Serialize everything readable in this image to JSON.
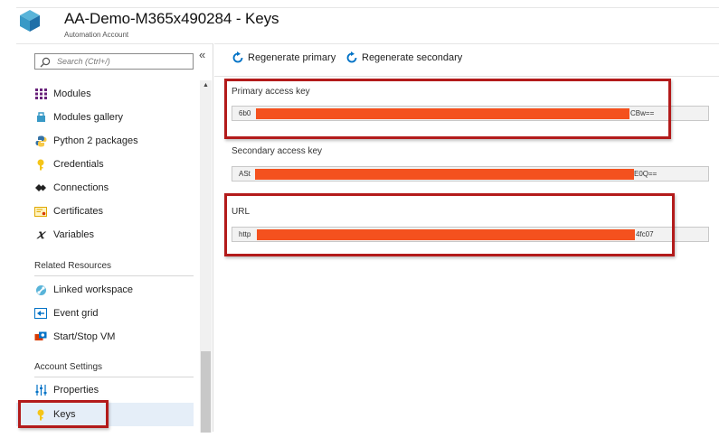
{
  "header": {
    "title": "AA-Demo-M365x490284 - Keys",
    "subtitle": "Automation Account",
    "icon": "cube-icon"
  },
  "sidebar": {
    "search_placeholder": "Search (Ctrl+/)",
    "collapse_glyph": "«",
    "items": [
      {
        "label": "Modules",
        "icon": "modules-icon"
      },
      {
        "label": "Modules gallery",
        "icon": "gallery-icon"
      },
      {
        "label": "Python 2 packages",
        "icon": "python-icon"
      },
      {
        "label": "Credentials",
        "icon": "key-icon"
      },
      {
        "label": "Connections",
        "icon": "connections-icon"
      },
      {
        "label": "Certificates",
        "icon": "certificate-icon"
      },
      {
        "label": "Variables",
        "icon": "variable-icon"
      }
    ],
    "related_header": "Related Resources",
    "related_items": [
      {
        "label": "Linked workspace",
        "icon": "workspace-icon"
      },
      {
        "label": "Event grid",
        "icon": "event-grid-icon"
      },
      {
        "label": "Start/Stop VM",
        "icon": "vm-icon"
      }
    ],
    "settings_header": "Account Settings",
    "settings_items": [
      {
        "label": "Properties",
        "icon": "properties-icon"
      },
      {
        "label": "Keys",
        "icon": "key-icon",
        "selected": true
      }
    ]
  },
  "toolbar": {
    "regen_primary": "Regenerate primary",
    "regen_secondary": "Regenerate secondary"
  },
  "fields": {
    "primary_label": "Primary access key",
    "primary_prefix": "6b0",
    "primary_suffix": "CBw==",
    "secondary_label": "Secondary access key",
    "secondary_prefix": "ASt",
    "secondary_suffix": "E0Q==",
    "url_label": "URL",
    "url_prefix": "http",
    "url_suffix": "4fc07"
  },
  "colors": {
    "accent": "#0072c6",
    "redaction": "#f4511e",
    "highlight": "#b31b1b",
    "selected_bg": "#e5eef8"
  }
}
